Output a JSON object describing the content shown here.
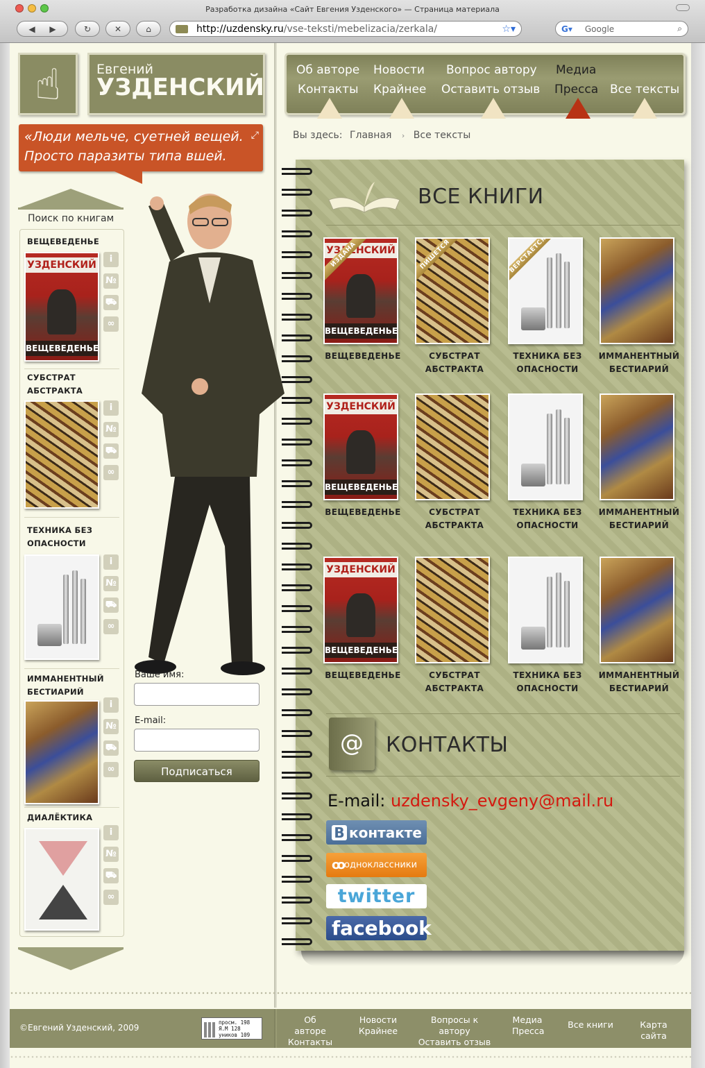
{
  "browser": {
    "window_title": "Разработка дизайна «Сайт Евгения Узденского» — Страница материала",
    "url_host": "http://uzdensky.ru",
    "url_path": "/vse-teksti/mebelizacia/zerkala/",
    "search_placeholder": "Google"
  },
  "logo": {
    "first_name": "Евгений",
    "last_name": "УЗДЕНСКИЙ"
  },
  "quote": {
    "line1": "«Люди мельче, суетней вещей.",
    "line2": "Просто паразиты типа вшей."
  },
  "sidebar": {
    "title": "Поиск по книгам",
    "books": [
      {
        "name": "ВЕЩЕВЕДЕНЬЕ",
        "cover": "magazine"
      },
      {
        "name": "СУБСТРАТ АБСТРАКТА",
        "cover": "abstract"
      },
      {
        "name": "ТЕХНИКА БЕЗ ОПАСНОСТИ",
        "cover": "tech"
      },
      {
        "name": "ИММАНЕНТНЫЙ БЕСТИАРИЙ",
        "cover": "bestiary"
      },
      {
        "name": "ДИАЛЁКТИКА",
        "cover": "dialectics"
      }
    ],
    "icons": [
      "info-icon",
      "number-icon",
      "cart-icon",
      "binoculars-icon"
    ]
  },
  "subscribe": {
    "name_label": "Ваше имя:",
    "email_label": "E-mail:",
    "button": "Подписаться"
  },
  "menu": {
    "items": [
      {
        "label": "Об авторе"
      },
      {
        "label": "Новости"
      },
      {
        "label": "Вопрос автору"
      },
      {
        "label": "Медиа"
      },
      {
        "label": "Контакты"
      },
      {
        "label": "Крайнее"
      },
      {
        "label": "Оставить отзыв"
      },
      {
        "label": "Пресса"
      },
      {
        "label": "Все тексты"
      }
    ]
  },
  "breadcrumb": {
    "prefix": "Вы здесь:",
    "home": "Главная",
    "current": "Все тексты"
  },
  "books_section": {
    "title": "ВСЕ КНИГИ",
    "ribbons": [
      "ИЗДАНА",
      "ПИШЕТСЯ",
      "ВЕРСТАЕТСЯ"
    ],
    "cover_mag_top": "УЗДЕНСКИЙ",
    "cover_mag_bottom": "ВЕЩЕВЕДЕНЬЕ",
    "rows": [
      [
        {
          "line1": "ВЕЩЕВЕДЕНЬЕ",
          "line2": ""
        },
        {
          "line1": "СУБСТРАТ",
          "line2": "АБСТРАКТА"
        },
        {
          "line1": "ТЕХНИКА БЕЗ",
          "line2": "ОПАСНОСТИ"
        },
        {
          "line1": "ИММАНЕНТНЫЙ",
          "line2": "БЕСТИАРИЙ"
        }
      ],
      [
        {
          "line1": "ВЕЩЕВЕДЕНЬЕ",
          "line2": ""
        },
        {
          "line1": "СУБСТРАТ",
          "line2": "АБСТРАКТА"
        },
        {
          "line1": "ТЕХНИКА БЕЗ",
          "line2": "ОПАСНОСТИ"
        },
        {
          "line1": "ИММАНЕНТНЫЙ",
          "line2": "БЕСТИАРИЙ"
        }
      ],
      [
        {
          "line1": "ВЕЩЕВЕДЕНЬЕ",
          "line2": ""
        },
        {
          "line1": "СУБСТРАТ",
          "line2": "АБСТРАКТА"
        },
        {
          "line1": "ТЕХНИКА БЕЗ",
          "line2": "ОПАСНОСТИ"
        },
        {
          "line1": "ИММАНЕНТНЫЙ",
          "line2": "БЕСТИАРИЙ"
        }
      ]
    ]
  },
  "contacts": {
    "title": "КОНТАКТЫ",
    "email_label": "E-mail:",
    "email": "uzdensky_evgeny@mail.ru",
    "social": {
      "vk": "контакте",
      "vk_badge": "В",
      "ok": "одноклассники",
      "twitter": "twitter",
      "facebook": "facebook"
    }
  },
  "footer": {
    "copyright": "©Евгений Узденский, 2009",
    "counter_line1": "просм. 198",
    "counter_line2": "Я.М 128",
    "counter_line3": "уников 109",
    "links": [
      {
        "line1": "Об авторе",
        "line2": "Контакты"
      },
      {
        "line1": "Новости",
        "line2": "Крайнее"
      },
      {
        "line1": "Вопросы к автору",
        "line2": "Оставить отзыв"
      },
      {
        "line1": "Медиа",
        "line2": "Пресса"
      },
      {
        "line1": "Все книги",
        "line2": ""
      },
      {
        "line1": "Карта сайта",
        "line2": ""
      }
    ]
  },
  "colors": {
    "olive": "#8a8c63",
    "quote_bg": "#c95427",
    "notebook_bg": "#b4b889",
    "email": "#d4190f",
    "page_bg": "#f8f8e8"
  }
}
